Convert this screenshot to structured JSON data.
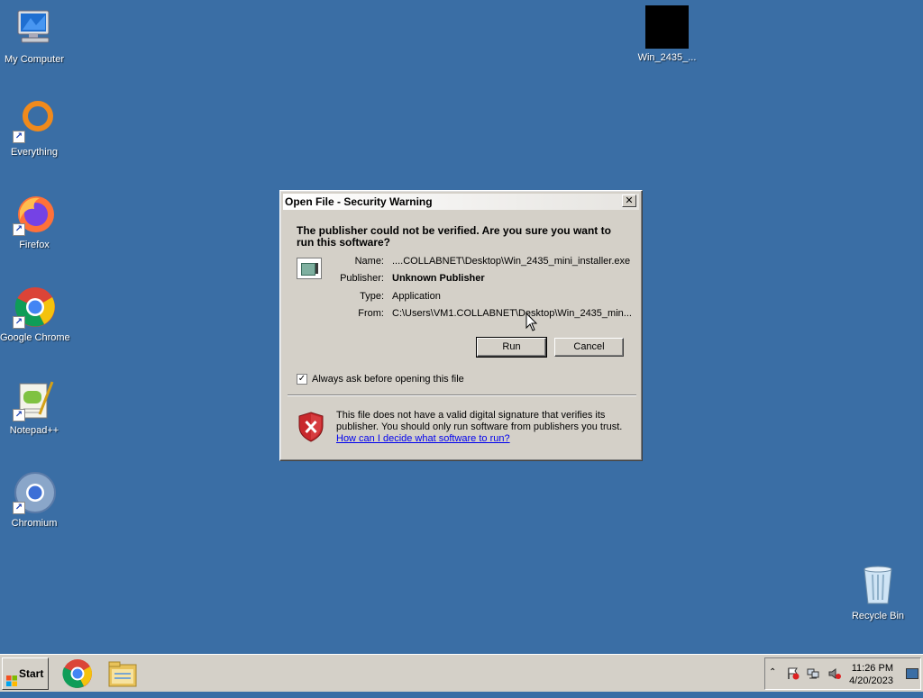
{
  "desktop": {
    "icons": [
      {
        "label": "My Computer"
      },
      {
        "label": "Everything"
      },
      {
        "label": "Firefox"
      },
      {
        "label": "Google Chrome"
      },
      {
        "label": "Notepad++"
      },
      {
        "label": "Chromium"
      },
      {
        "label": "Win_2435_..."
      },
      {
        "label": "Recycle Bin"
      }
    ]
  },
  "dialog": {
    "title": "Open File - Security Warning",
    "close_label": "✕",
    "question": "The publisher could not be verified.  Are you sure you want to run this software?",
    "fields": [
      {
        "key": "Name:",
        "value": "....COLLABNET\\Desktop\\Win_2435_mini_installer.exe"
      },
      {
        "key": "Publisher:",
        "value": "Unknown Publisher"
      },
      {
        "key": "Type:",
        "value": "Application"
      },
      {
        "key": "From:",
        "value": "C:\\Users\\VM1.COLLABNET\\Desktop\\Win_2435_min..."
      }
    ],
    "run_label": "Run",
    "cancel_label": "Cancel",
    "checkbox": {
      "checked": true,
      "mark": "✓",
      "label": "Always ask before opening this file"
    },
    "warning_text": "This file does not have a valid digital signature that verifies its publisher.  You should only run software from publishers you trust.",
    "warning_link": "How can I decide what software to run?"
  },
  "taskbar": {
    "start_label": "Start",
    "tray_arrow": "⌃",
    "clock_time": "11:26 PM",
    "clock_date": "4/20/2023"
  },
  "colors": {
    "desktop": "#3a6ea5",
    "dialog_face": "#d4d0c8",
    "link": "#0000ee"
  }
}
